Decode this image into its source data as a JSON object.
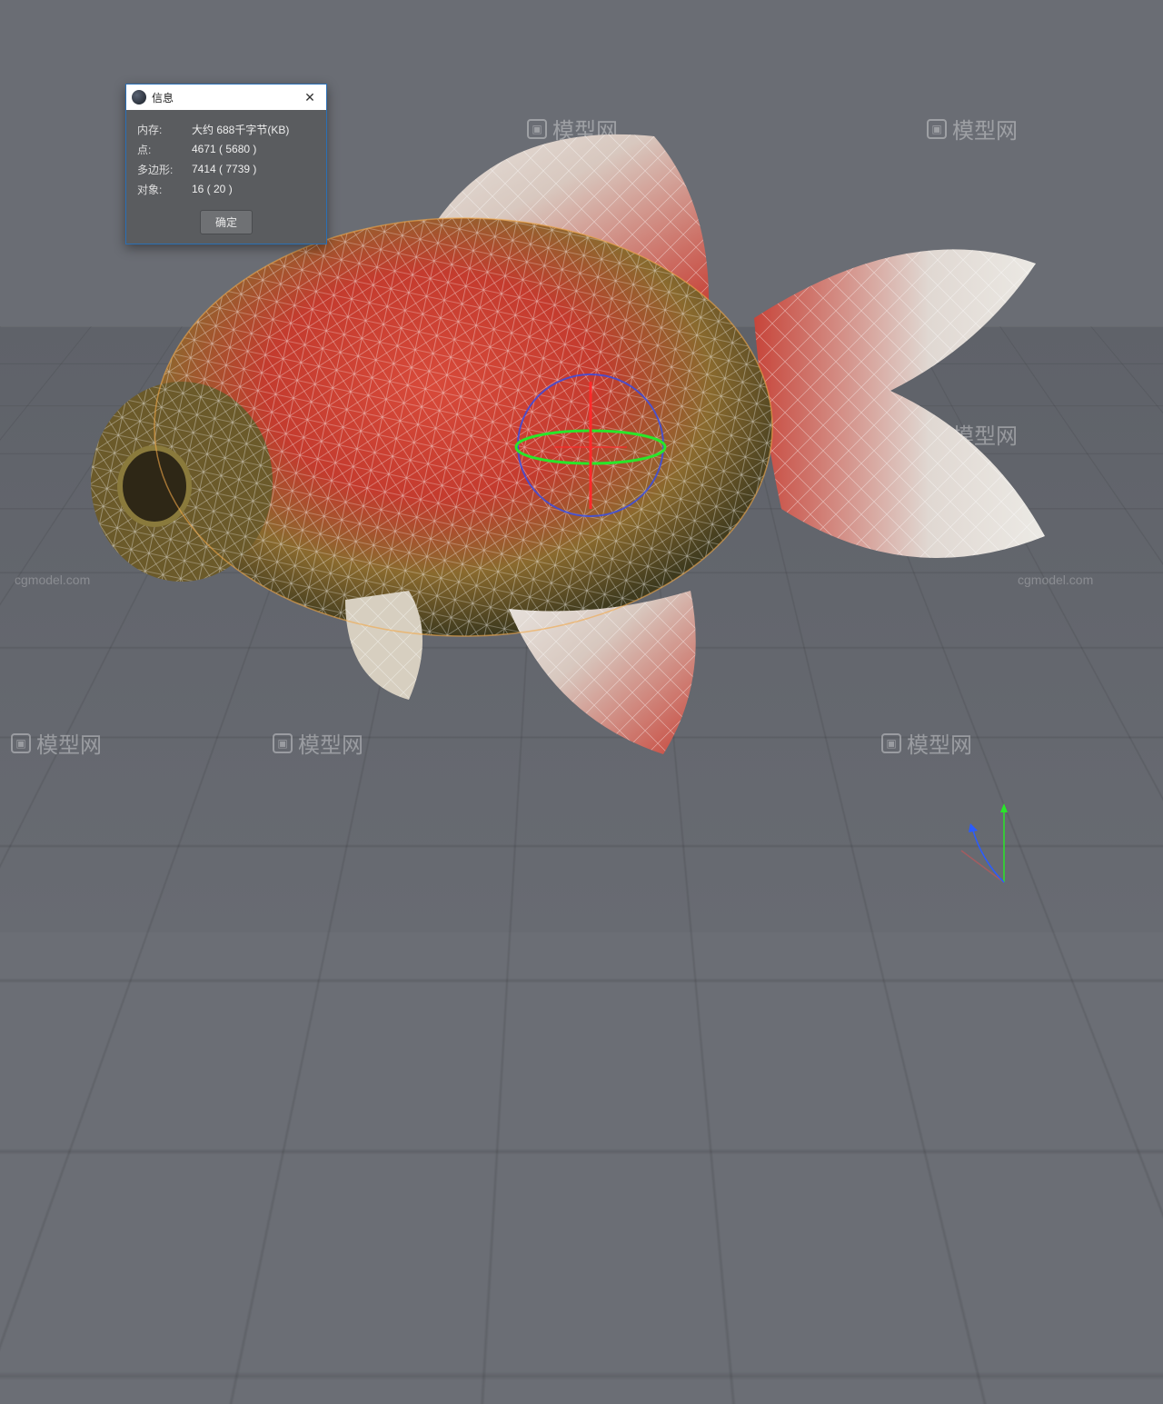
{
  "dialog": {
    "title": "信息",
    "rows": [
      {
        "label": "内存:",
        "value": "大约 688千字节(KB)"
      },
      {
        "label": "点:",
        "value": "4671 ( 5680 )"
      },
      {
        "label": "多边形:",
        "value": "7414 ( 7739 )"
      },
      {
        "label": "对象:",
        "value": "16 ( 20 )"
      }
    ],
    "ok_label": "确定"
  },
  "watermark": {
    "brand": "模型网",
    "domain": "cgmodel.com"
  },
  "gizmo": {
    "axis_colors": {
      "x": "#ff2a2a",
      "y": "#29e629",
      "z": "#2a5cff"
    }
  }
}
